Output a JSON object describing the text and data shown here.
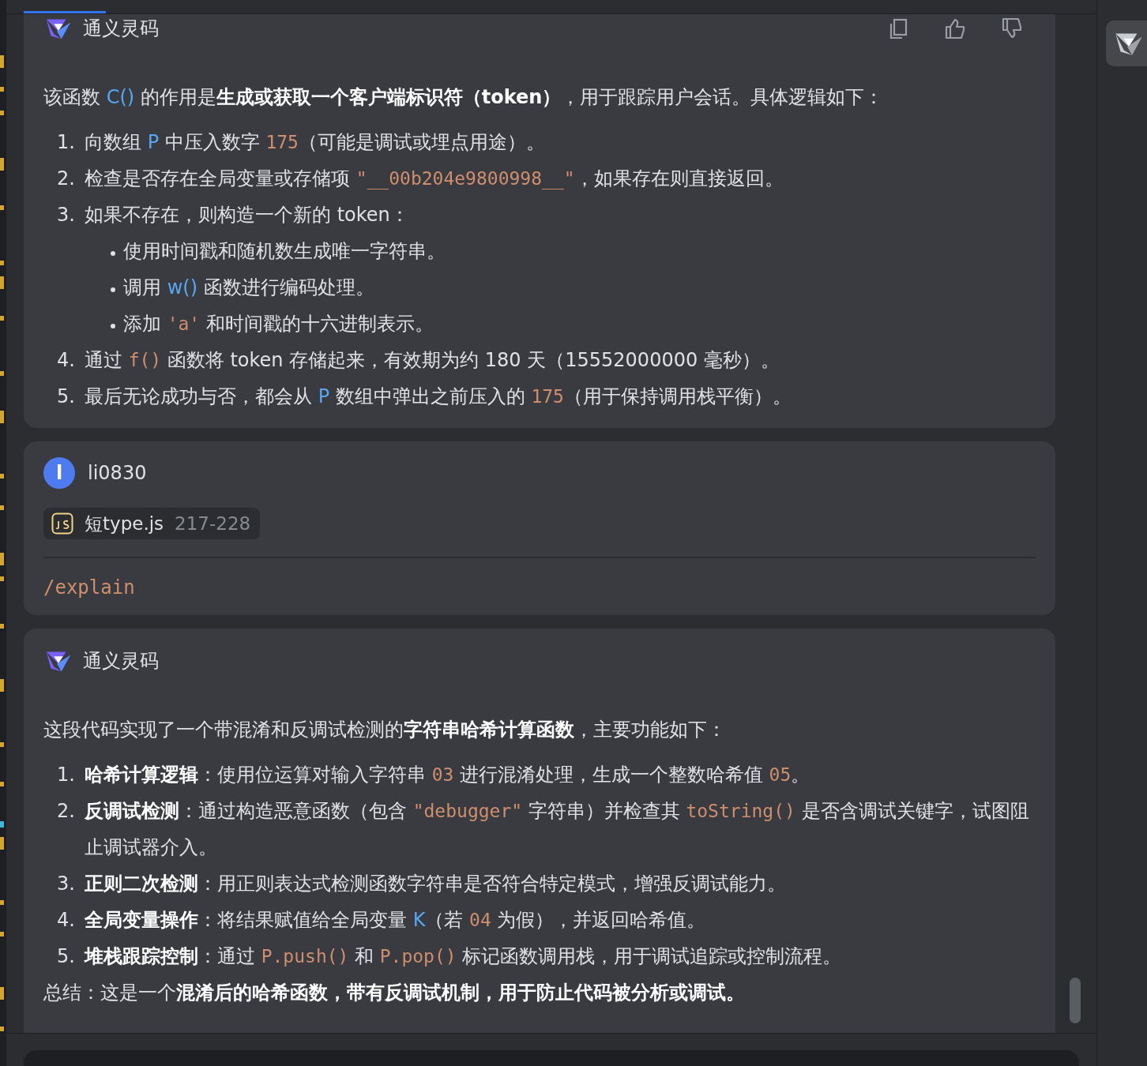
{
  "top_tabs": [
    {
      "selected": true
    }
  ],
  "messages": [
    {
      "kind": "assistant",
      "author": "通义灵码",
      "actions": [
        {
          "kind": "copy"
        },
        {
          "kind": "like"
        },
        {
          "kind": "dislike"
        }
      ],
      "blocks": [
        {
          "kind": "paragraph",
          "segments": [
            {
              "kind": "text",
              "text": "该函数 "
            },
            {
              "kind": "ident",
              "text": "C()"
            },
            {
              "kind": "text",
              "text": " 的作用是"
            },
            {
              "kind": "bold",
              "text": "生成或获取一个客户端标识符（token）"
            },
            {
              "kind": "text",
              "text": "，用于跟踪用户会话。具体逻辑如下："
            }
          ]
        },
        {
          "kind": "numbered",
          "number": "1.",
          "segments": [
            {
              "kind": "text",
              "text": "向数组 "
            },
            {
              "kind": "ident",
              "text": "P"
            },
            {
              "kind": "text",
              "text": " 中压入数字 "
            },
            {
              "kind": "code",
              "text": "175"
            },
            {
              "kind": "text",
              "text": "（可能是调试或埋点用途）。"
            }
          ]
        },
        {
          "kind": "numbered",
          "number": "2.",
          "segments": [
            {
              "kind": "text",
              "text": "检查是否存在全局变量或存储项 "
            },
            {
              "kind": "code",
              "text": "\"__00b204e9800998__\""
            },
            {
              "kind": "text",
              "text": "，如果存在则直接返回。"
            }
          ]
        },
        {
          "kind": "numbered",
          "number": "3.",
          "segments": [
            {
              "kind": "text",
              "text": "如果不存在，则构造一个新的 token："
            }
          ]
        },
        {
          "kind": "bullet",
          "segments": [
            {
              "kind": "text",
              "text": "使用时间戳和随机数生成唯一字符串。"
            }
          ]
        },
        {
          "kind": "bullet",
          "segments": [
            {
              "kind": "text",
              "text": "调用 "
            },
            {
              "kind": "ident",
              "text": "w()"
            },
            {
              "kind": "text",
              "text": " 函数进行编码处理。"
            }
          ]
        },
        {
          "kind": "bullet",
          "segments": [
            {
              "kind": "text",
              "text": "添加 "
            },
            {
              "kind": "code",
              "text": "'a'"
            },
            {
              "kind": "text",
              "text": " 和时间戳的十六进制表示。"
            }
          ]
        },
        {
          "kind": "numbered",
          "number": "4.",
          "segments": [
            {
              "kind": "text",
              "text": "通过 "
            },
            {
              "kind": "code",
              "text": "f()"
            },
            {
              "kind": "text",
              "text": " 函数将 token 存储起来，有效期为约 180 天（15552000000 毫秒）。"
            }
          ]
        },
        {
          "kind": "numbered",
          "number": "5.",
          "segments": [
            {
              "kind": "text",
              "text": "最后无论成功与否，都会从 "
            },
            {
              "kind": "ident",
              "text": "P"
            },
            {
              "kind": "text",
              "text": " 数组中弹出之前压入的 "
            },
            {
              "kind": "code",
              "text": "175"
            },
            {
              "kind": "text",
              "text": "（用于保持调用栈平衡）。"
            }
          ]
        }
      ]
    },
    {
      "kind": "user",
      "author": "li0830",
      "avatar": "l",
      "file": {
        "name": "短type.js",
        "lines": "217-228"
      },
      "command": "/explain"
    },
    {
      "kind": "assistant",
      "author": "通义灵码",
      "blocks": [
        {
          "kind": "paragraph",
          "segments": [
            {
              "kind": "text",
              "text": "这段代码实现了一个带混淆和反调试检测的"
            },
            {
              "kind": "bold",
              "text": "字符串哈希计算函数"
            },
            {
              "kind": "text",
              "text": "，主要功能如下："
            }
          ]
        },
        {
          "kind": "numbered",
          "number": "1.",
          "segments": [
            {
              "kind": "bold",
              "text": "哈希计算逻辑"
            },
            {
              "kind": "text",
              "text": "：使用位运算对输入字符串 "
            },
            {
              "kind": "code",
              "text": "03"
            },
            {
              "kind": "text",
              "text": " 进行混淆处理，生成一个整数哈希值 "
            },
            {
              "kind": "code",
              "text": "05"
            },
            {
              "kind": "text",
              "text": "。"
            }
          ]
        },
        {
          "kind": "numbered",
          "number": "2.",
          "segments": [
            {
              "kind": "bold",
              "text": "反调试检测"
            },
            {
              "kind": "text",
              "text": "：通过构造恶意函数（包含 "
            },
            {
              "kind": "code",
              "text": "\"debugger\""
            },
            {
              "kind": "text",
              "text": " 字符串）并检查其 "
            },
            {
              "kind": "code",
              "text": "toString()"
            },
            {
              "kind": "text",
              "text": " 是否含调试关键字，试图阻止调试器介入。"
            }
          ]
        },
        {
          "kind": "numbered",
          "number": "3.",
          "segments": [
            {
              "kind": "bold",
              "text": "正则二次检测"
            },
            {
              "kind": "text",
              "text": "：用正则表达式检测函数字符串是否符合特定模式，增强反调试能力。"
            }
          ]
        },
        {
          "kind": "numbered",
          "number": "4.",
          "segments": [
            {
              "kind": "bold",
              "text": "全局变量操作"
            },
            {
              "kind": "text",
              "text": "：将结果赋值给全局变量 "
            },
            {
              "kind": "ident",
              "text": "K"
            },
            {
              "kind": "text",
              "text": "（若 "
            },
            {
              "kind": "code",
              "text": "04"
            },
            {
              "kind": "text",
              "text": " 为假），并返回哈希值。"
            }
          ]
        },
        {
          "kind": "numbered",
          "number": "5.",
          "segments": [
            {
              "kind": "bold",
              "text": "堆栈跟踪控制"
            },
            {
              "kind": "text",
              "text": "：通过 "
            },
            {
              "kind": "code",
              "text": "P.push()"
            },
            {
              "kind": "text",
              "text": " 和 "
            },
            {
              "kind": "code",
              "text": "P.pop()"
            },
            {
              "kind": "text",
              "text": " 标记函数调用栈，用于调试追踪或控制流程。"
            }
          ]
        },
        {
          "kind": "summary",
          "segments": [
            {
              "kind": "text",
              "text": "总结：这是一个"
            },
            {
              "kind": "bold",
              "text": "混淆后的哈希函数，带有反调试机制，用于防止代码被分析或调试。"
            }
          ]
        }
      ]
    }
  ]
}
